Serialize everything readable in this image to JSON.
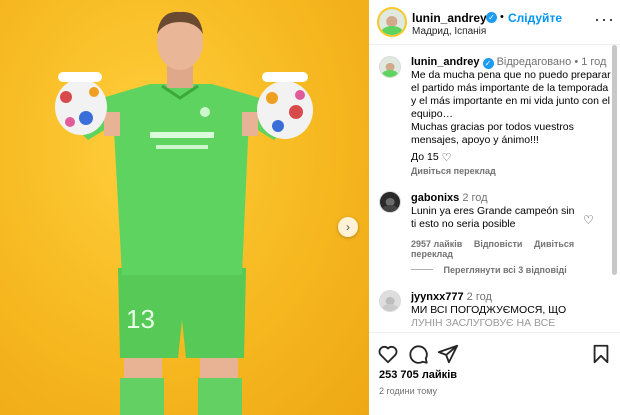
{
  "post": {
    "username": "lunin_andrey",
    "verified_mark": "✓",
    "separator": "•",
    "follow_label": "Слідуйте",
    "location": "Мадрид, Іспанія",
    "more_icon": "···",
    "next_icon": "›"
  },
  "caption": {
    "username": "lunin_andrey",
    "edited": "Відредаговано",
    "time": "1 год",
    "text": "Me da mucha pena que no puedo preparar el partido más importante de la temporada y el más importante en mi vida junto con el equipo…\nMuchas gracias por todos vuestros mensajes, apoyo y ánimo!!!",
    "likes_prefix": "До 15",
    "translate": "Дивіться переклад"
  },
  "comments": [
    {
      "username": "gabonixs",
      "time": "2 год",
      "text": "Lunin ya eres Grande campeón sin ti esto no seria posible",
      "likes": "2957 лайків",
      "reply": "Відповісти",
      "translate": "Дивіться переклад",
      "view_replies": "Переглянути всі 3 відповіді"
    },
    {
      "username": "jyynxx777",
      "time": "2 год",
      "text": "МИ ВСІ ПОГОДЖУЄМОСЯ, ЩО",
      "text_cut": "ЛУНІН ЗАСЛУГОВУЄ НА ВСЕ"
    }
  ],
  "footer": {
    "likes": "253 705 лайків",
    "time": "2 години тому"
  },
  "icons": {
    "heart": "heart-icon",
    "comment": "comment-icon",
    "share": "share-icon",
    "save": "bookmark-icon"
  },
  "colors": {
    "background": "#f6b820",
    "kit": "#5fd35f",
    "link": "#0095f6",
    "verified": "#1d9bf0"
  }
}
